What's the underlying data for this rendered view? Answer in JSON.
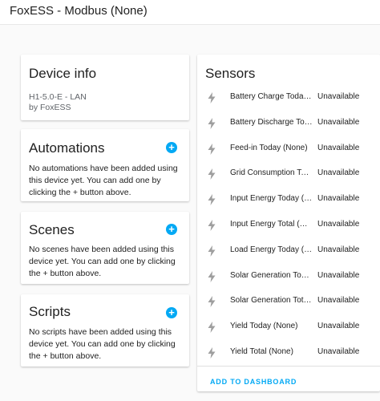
{
  "window": {
    "title": "FoxESS - Modbus (None)"
  },
  "device_info": {
    "title": "Device info",
    "model": "H1-5.0-E - LAN",
    "manufacturer": "by FoxESS"
  },
  "automations": {
    "title": "Automations",
    "text": "No automations have been added using this device yet. You can add one by clicking the + button above.",
    "add_label": "+"
  },
  "scenes": {
    "title": "Scenes",
    "text": "No scenes have been added using this device yet. You can add one by clicking the + button above.",
    "add_label": "+"
  },
  "scripts": {
    "title": "Scripts",
    "text": "No scripts have been added using this device yet. You can add one by clicking the + button above.",
    "add_label": "+"
  },
  "sensors": {
    "title": "Sensors",
    "items": [
      {
        "name": "Battery Charge Today (None)",
        "state": "Unavailable"
      },
      {
        "name": "Battery Discharge Today (None)",
        "state": "Unavailable"
      },
      {
        "name": "Feed-in Today (None)",
        "state": "Unavailable"
      },
      {
        "name": "Grid Consumption Today (None)",
        "state": "Unavailable"
      },
      {
        "name": "Input Energy Today (None)",
        "state": "Unavailable"
      },
      {
        "name": "Input Energy Total (None)",
        "state": "Unavailable"
      },
      {
        "name": "Load Energy Today (None)",
        "state": "Unavailable"
      },
      {
        "name": "Solar Generation Today (None)",
        "state": "Unavailable"
      },
      {
        "name": "Solar Generation Total (None)",
        "state": "Unavailable"
      },
      {
        "name": "Yield Today (None)",
        "state": "Unavailable"
      },
      {
        "name": "Yield Total (None)",
        "state": "Unavailable"
      }
    ],
    "action_label": "ADD TO DASHBOARD"
  },
  "colors": {
    "accent": "#03a9f4",
    "icon": "#9e9e9e"
  }
}
